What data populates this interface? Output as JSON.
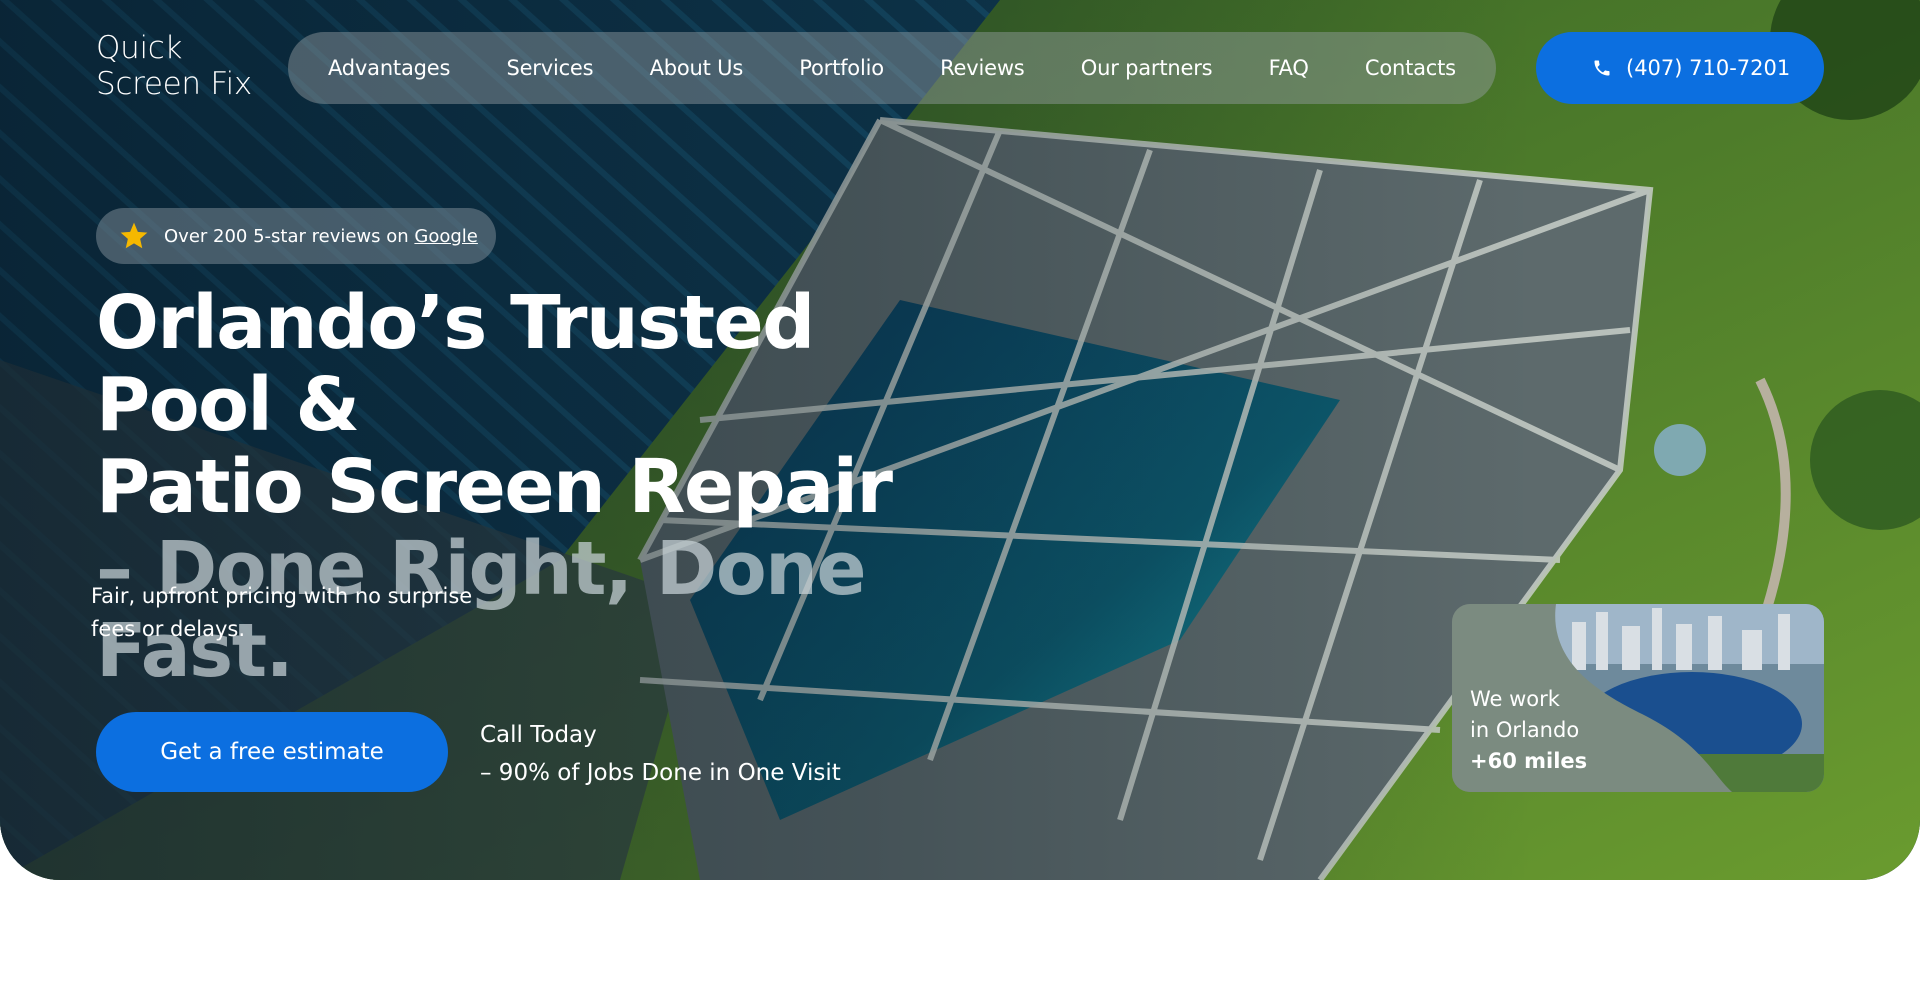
{
  "brand": {
    "name": "Quick\nScreen Fix"
  },
  "nav": {
    "items": [
      "Advantages",
      "Services",
      "About Us",
      "Portfolio",
      "Reviews",
      "Our partners",
      "FAQ",
      "Contacts"
    ]
  },
  "header": {
    "phone": "(407) 710-7201",
    "phone_icon": "phone-icon"
  },
  "reviews": {
    "text": "Over 200 5-star reviews on ",
    "link": "Google",
    "icon": "star-icon"
  },
  "hero": {
    "title_line1": "Orlando’s Trusted Pool &",
    "title_line2": "Patio Screen Repair",
    "title_line3": "– Done Right, Done Fast.",
    "subtitle": "Fair, upfront pricing with no surprise fees or delays.",
    "cta_label": "Get a free estimate",
    "call_line1": "Call Today",
    "call_line2": "– 90% of Jobs Done in One Visit"
  },
  "area": {
    "line1": "We work",
    "line2": "in Orlando",
    "line3": "+60 miles"
  },
  "colors": {
    "accent": "#0c6fe0",
    "star": "#f5b800"
  }
}
